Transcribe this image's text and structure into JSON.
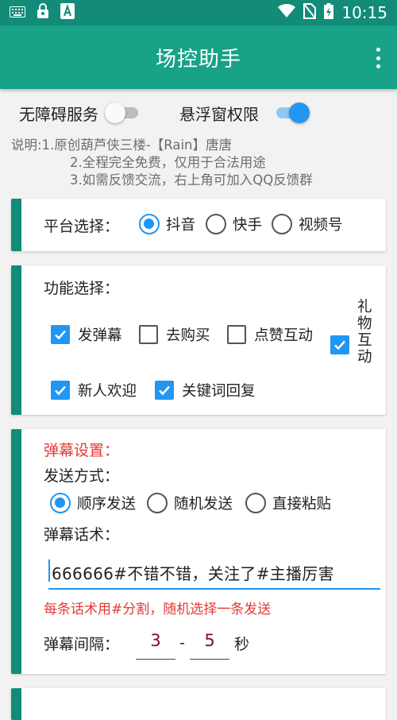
{
  "status_bar": {
    "time": "10:15",
    "left_icons": [
      "keyboard-icon",
      "lock-icon",
      "a-text-icon"
    ],
    "right_icons": [
      "wifi-icon",
      "no-sim-icon",
      "battery-charging-icon"
    ]
  },
  "app_bar": {
    "title": "场控助手",
    "menu_icon": "more-vert-icon"
  },
  "permissions": {
    "accessibility_label": "无障碍服务",
    "accessibility_on": false,
    "overlay_label": "悬浮窗权限",
    "overlay_on": true
  },
  "description": {
    "line1": "说明:1.原创葫芦侠三楼-【Rain】唐唐",
    "line2": "2.全程完全免费，仅用于合法用途",
    "line3": "3.如需反馈交流，右上角可加入QQ反馈群"
  },
  "platform": {
    "label": "平台选择：",
    "options": [
      "抖音",
      "快手",
      "视频号"
    ],
    "selected": 0
  },
  "features": {
    "label": "功能选择：",
    "items": [
      {
        "label": "发弹幕",
        "checked": true
      },
      {
        "label": "去购买",
        "checked": false
      },
      {
        "label": "点赞互动",
        "checked": false
      },
      {
        "label": "礼物互动",
        "checked": true
      },
      {
        "label": "新人欢迎",
        "checked": true
      },
      {
        "label": "关键词回复",
        "checked": true
      }
    ]
  },
  "danmaku": {
    "title": "弹幕设置：",
    "send_mode_label": "发送方式：",
    "send_modes": [
      "顺序发送",
      "随机发送",
      "直接粘贴"
    ],
    "send_mode_selected": 0,
    "script_label": "弹幕话术：",
    "script_value": "666666#不错不错，关注了#主播厉害",
    "hint": "每条话术用#分割，随机选择一条发送",
    "interval_label": "弹幕间隔：",
    "interval_min": "3",
    "interval_sep": "-",
    "interval_max": "5",
    "interval_unit": "秒"
  },
  "colors": {
    "status_bar": "#128c79",
    "app_bar": "#18a288",
    "accent": "#2196f3",
    "card_stripe": "#128c79",
    "warning_text": "#e53935"
  }
}
